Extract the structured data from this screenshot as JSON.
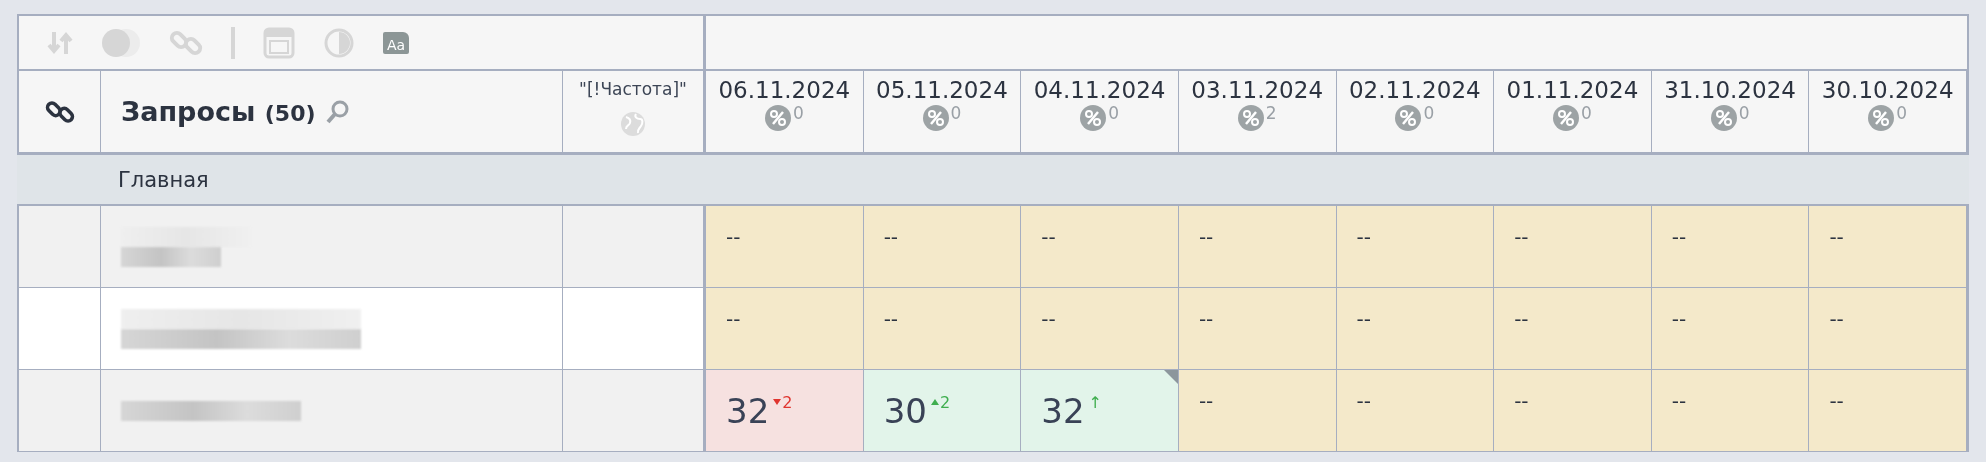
{
  "toolbar": [
    {
      "kind": "sort",
      "disabled": true
    },
    {
      "kind": "toggle",
      "disabled": true
    },
    {
      "kind": "link",
      "disabled": true
    },
    {
      "kind": "separator",
      "disabled": true
    },
    {
      "kind": "window",
      "disabled": true
    },
    {
      "kind": "contrast",
      "disabled": true
    },
    {
      "kind": "font",
      "disabled": false,
      "label": "Aa"
    }
  ],
  "header": {
    "title": "Запросы",
    "count": "(50)",
    "frequency_label": "\"[!Частота]\"",
    "dates": [
      {
        "date": "06.11.2024",
        "count": "0"
      },
      {
        "date": "05.11.2024",
        "count": "0"
      },
      {
        "date": "04.11.2024",
        "count": "0"
      },
      {
        "date": "03.11.2024",
        "count": "2"
      },
      {
        "date": "02.11.2024",
        "count": "0"
      },
      {
        "date": "01.11.2024",
        "count": "0"
      },
      {
        "date": "31.10.2024",
        "count": "0"
      },
      {
        "date": "30.10.2024",
        "count": "0"
      }
    ]
  },
  "group": {
    "title": "Главная"
  },
  "rows": [
    {
      "highlighted": false,
      "cells": [
        {
          "value": "--"
        },
        {
          "value": "--"
        },
        {
          "value": "--"
        },
        {
          "value": "--"
        },
        {
          "value": "--"
        },
        {
          "value": "--"
        },
        {
          "value": "--"
        },
        {
          "value": "--"
        }
      ]
    },
    {
      "highlighted": true,
      "cells": [
        {
          "value": "--"
        },
        {
          "value": "--"
        },
        {
          "value": "--"
        },
        {
          "value": "--"
        },
        {
          "value": "--"
        },
        {
          "value": "--"
        },
        {
          "value": "--"
        },
        {
          "value": "--"
        }
      ]
    },
    {
      "highlighted": false,
      "cells": [
        {
          "value": "32",
          "delta": "2",
          "kind": "down"
        },
        {
          "value": "30",
          "delta": "2",
          "kind": "up"
        },
        {
          "value": "32",
          "delta": "↑",
          "kind": "new",
          "flagged": true
        },
        {
          "value": "--"
        },
        {
          "value": "--"
        },
        {
          "value": "--"
        },
        {
          "value": "--"
        },
        {
          "value": "--"
        }
      ]
    }
  ]
}
